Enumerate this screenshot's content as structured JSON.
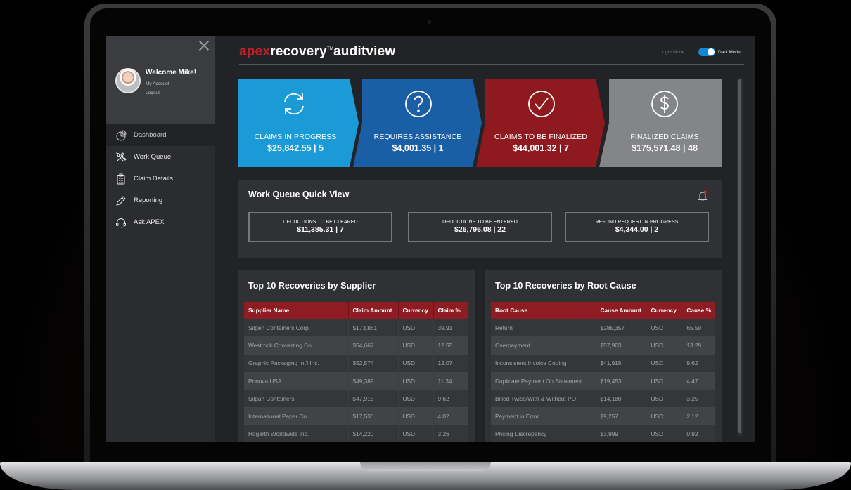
{
  "app": {
    "logo_brand": "apex",
    "logo_product": "recovery",
    "logo_tm": "TM",
    "logo_module": "auditview"
  },
  "mode": {
    "light_label": "Light Mode",
    "dark_label": "Dark Mode",
    "dark_enabled": true,
    "accent": "#1386d6"
  },
  "user": {
    "welcome": "Welcome Mike!",
    "my_account": "My Account",
    "logout": "Logout"
  },
  "nav": {
    "items": [
      {
        "label": "Dashboard",
        "icon": "pie-chart-icon",
        "active": true
      },
      {
        "label": "Work Queue",
        "icon": "tools-icon",
        "active": false
      },
      {
        "label": "Claim Details",
        "icon": "clipboard-icon",
        "active": false
      },
      {
        "label": "Reporting",
        "icon": "pencil-icon",
        "active": false
      },
      {
        "label": "Ask APEX",
        "icon": "headset-icon",
        "active": false
      }
    ]
  },
  "cards": [
    {
      "label": "CLAIMS IN PROGRESS",
      "value": "$25,842.55 | 5",
      "icon": "refresh-icon",
      "color": "#1a9ad6"
    },
    {
      "label": "REQUIRES ASSISTANCE",
      "value": "$4,001.35 | 1",
      "icon": "question-icon",
      "color": "#1a5ea6"
    },
    {
      "label": "CLAIMS TO BE FINALIZED",
      "value": "$44,001.32 | 7",
      "icon": "check-icon",
      "color": "#8e1a1f"
    },
    {
      "label": "FINALIZED CLAIMS",
      "value": "$175,571.48 | 48",
      "icon": "dollar-icon",
      "color": "#848588"
    }
  ],
  "work_queue": {
    "title": "Work Queue Quick View",
    "items": [
      {
        "label": "DEDUCTIONS TO BE CLEARED",
        "value": "$11,385.31 | 7"
      },
      {
        "label": "DEDUCTIONS TO BE ENTERED",
        "value": "$26,796.08 | 22"
      },
      {
        "label": "REFUND REQUEST IN PROGRESS",
        "value": "$4,344.00 | 2"
      }
    ]
  },
  "supplier_table": {
    "title": "Top 10 Recoveries by Supplier",
    "columns": [
      "Supplier Name",
      "Claim Amount",
      "Currency",
      "Claim %"
    ],
    "rows": [
      [
        "Silgen Containers Corp.",
        "$173,861",
        "USD",
        "39.91"
      ],
      [
        "Westrock Converting Co.",
        "$54,667",
        "USD",
        "12.55"
      ],
      [
        "Graphic Packaging Int'l Inc.",
        "$52,574",
        "USD",
        "12.07"
      ],
      [
        "Prinova USA",
        "$49,389",
        "USD",
        "11.34"
      ],
      [
        "Silgan Containers",
        "$47,915",
        "USD",
        "9.62"
      ],
      [
        "International Paper Co.",
        "$17,530",
        "USD",
        "4.02"
      ],
      [
        "Hogarth Worldwide Inc.",
        "$14,220",
        "USD",
        "3.26"
      ]
    ]
  },
  "rootcause_table": {
    "title": "Top 10 Recoveries by Root Cause",
    "columns": [
      "Root Cause",
      "Cause Amount",
      "Currency",
      "Cause %"
    ],
    "rows": [
      [
        "Return",
        "$285,357",
        "USD",
        "65.50"
      ],
      [
        "Overpayment",
        "$57,903",
        "USD",
        "13.29"
      ],
      [
        "Inconsistent Invoice Coding",
        "$41,915",
        "USD",
        "9.62"
      ],
      [
        "Duplicate Payment On Statement",
        "$19,453",
        "USD",
        "4.47"
      ],
      [
        "Billed Twice/With & Without PO",
        "$14,180",
        "USD",
        "3.25"
      ],
      [
        "Payment in Error",
        "$9,257",
        "USD",
        "2.12"
      ],
      [
        "Pricing Discrepency",
        "$3,999",
        "USD",
        "0.92"
      ]
    ]
  },
  "colors": {
    "header_red": "#8f1c22",
    "brand_red": "#c4202a"
  }
}
